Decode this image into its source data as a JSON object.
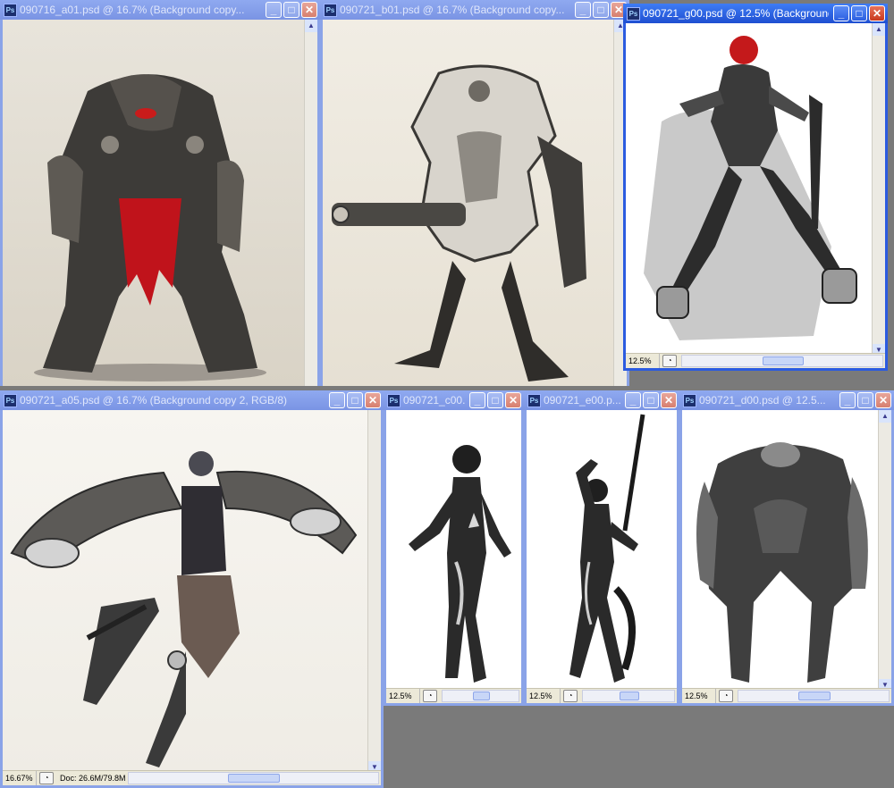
{
  "windows": [
    {
      "id": "a01",
      "title": "090716_a01.psd @ 16.7% (Background copy...",
      "zoom": "",
      "doc": "",
      "active": false
    },
    {
      "id": "b01",
      "title": "090721_b01.psd @ 16.7% (Background copy...",
      "zoom": "",
      "doc": "",
      "active": false
    },
    {
      "id": "g00",
      "title": "090721_g00.psd @ 12.5% (Background...",
      "zoom": "12.5%",
      "doc": "",
      "active": true
    },
    {
      "id": "a05",
      "title": "090721_a05.psd @ 16.7% (Background copy 2, RGB/8)",
      "zoom": "16.67%",
      "doc": "Doc: 26.6M/79.8M",
      "active": false
    },
    {
      "id": "c00",
      "title": "090721_c00.p...",
      "zoom": "12.5%",
      "doc": "",
      "active": false
    },
    {
      "id": "e00",
      "title": "090721_e00.p...",
      "zoom": "12.5%",
      "doc": "",
      "active": false
    },
    {
      "id": "d00",
      "title": "090721_d00.psd @ 12.5...",
      "zoom": "12.5%",
      "doc": "",
      "active": false
    }
  ],
  "buttons": {
    "minimize": "_",
    "maximize": "□",
    "close": "✕"
  },
  "icons": {
    "ps": "Ps",
    "nav": "◔"
  }
}
